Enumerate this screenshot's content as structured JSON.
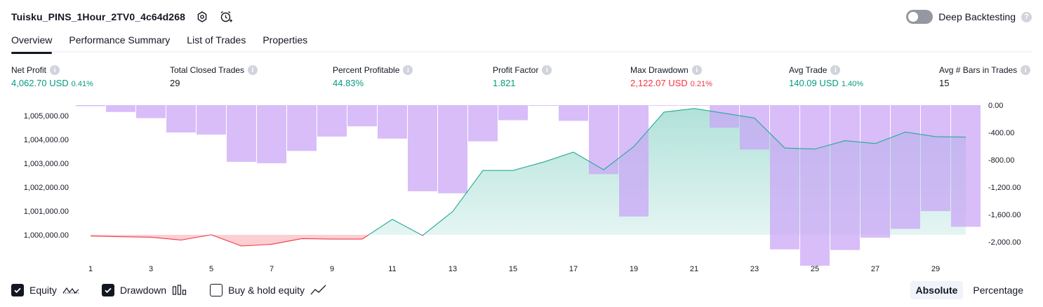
{
  "header": {
    "title": "Tuisku_PINS_1Hour_2TV0_4c64d268",
    "deep_backtesting_label": "Deep Backtesting"
  },
  "tabs": [
    {
      "label": "Overview",
      "active": true
    },
    {
      "label": "Performance Summary",
      "active": false
    },
    {
      "label": "List of Trades",
      "active": false
    },
    {
      "label": "Properties",
      "active": false
    }
  ],
  "metrics": {
    "net_profit": {
      "label": "Net Profit",
      "value": "4,062.70 USD",
      "pct": "0.41%"
    },
    "total_closed_trades": {
      "label": "Total Closed Trades",
      "value": "29"
    },
    "percent_profitable": {
      "label": "Percent Profitable",
      "value": "44.83%"
    },
    "profit_factor": {
      "label": "Profit Factor",
      "value": "1.821"
    },
    "max_drawdown": {
      "label": "Max Drawdown",
      "value": "2,122.07 USD",
      "pct": "0.21%"
    },
    "avg_trade": {
      "label": "Avg Trade",
      "value": "140.09 USD",
      "pct": "1.40%"
    },
    "avg_bars": {
      "label": "Avg # Bars in Trades",
      "value": "15"
    }
  },
  "chart_data": {
    "type": "line",
    "x": [
      1,
      2,
      3,
      4,
      5,
      6,
      7,
      8,
      9,
      10,
      11,
      12,
      13,
      14,
      15,
      16,
      17,
      18,
      19,
      20,
      21,
      22,
      23,
      24,
      25,
      26,
      27,
      28,
      29,
      30
    ],
    "x_ticks": [
      "1",
      "3",
      "5",
      "7",
      "9",
      "11",
      "13",
      "15",
      "17",
      "19",
      "21",
      "23",
      "25",
      "27",
      "29"
    ],
    "left_axis": {
      "ticks": [
        "1,000,000.00",
        "1,001,000.00",
        "1,002,000.00",
        "1,003,000.00",
        "1,004,000.00",
        "1,005,000.00"
      ],
      "ylim": [
        999000,
        1005400
      ]
    },
    "right_axis": {
      "ticks": [
        "0.00",
        "-400.00",
        "-800.00",
        "-1,200.00",
        "-1,600.00",
        "-2,000.00"
      ],
      "ylim": [
        -2200,
        0
      ]
    },
    "series": [
      {
        "name": "Equity",
        "axis": "left",
        "values": [
          999950,
          999920,
          999900,
          999780,
          1000000,
          999530,
          999600,
          999840,
          999820,
          999820,
          1000650,
          999970,
          1000980,
          1002700,
          1002700,
          1003050,
          1003470,
          1002730,
          1003700,
          1005150,
          1005300,
          1005100,
          1004900,
          1003640,
          1003600,
          1003950,
          1003830,
          1004310,
          1004120,
          1004100
        ]
      },
      {
        "name": "Drawdown",
        "axis": "right",
        "values": [
          -15,
          -100,
          -190,
          -400,
          -430,
          -830,
          -850,
          -670,
          -460,
          -310,
          -490,
          -1260,
          -1290,
          -530,
          -220,
          -10,
          -230,
          -1010,
          -1630,
          0,
          0,
          -330,
          -650,
          -2110,
          -2350,
          -2120,
          -1940,
          -1810,
          -1550,
          -1780
        ]
      }
    ],
    "colors": {
      "equity_up": "#22ab94",
      "equity_down": "#f23645",
      "drawdown": "#c9a3f7"
    }
  },
  "legend": [
    {
      "label": "Equity",
      "checked": true
    },
    {
      "label": "Drawdown",
      "checked": true
    },
    {
      "label": "Buy & hold equity",
      "checked": false
    }
  ],
  "modes": [
    {
      "label": "Absolute",
      "active": true
    },
    {
      "label": "Percentage",
      "active": false
    }
  ]
}
